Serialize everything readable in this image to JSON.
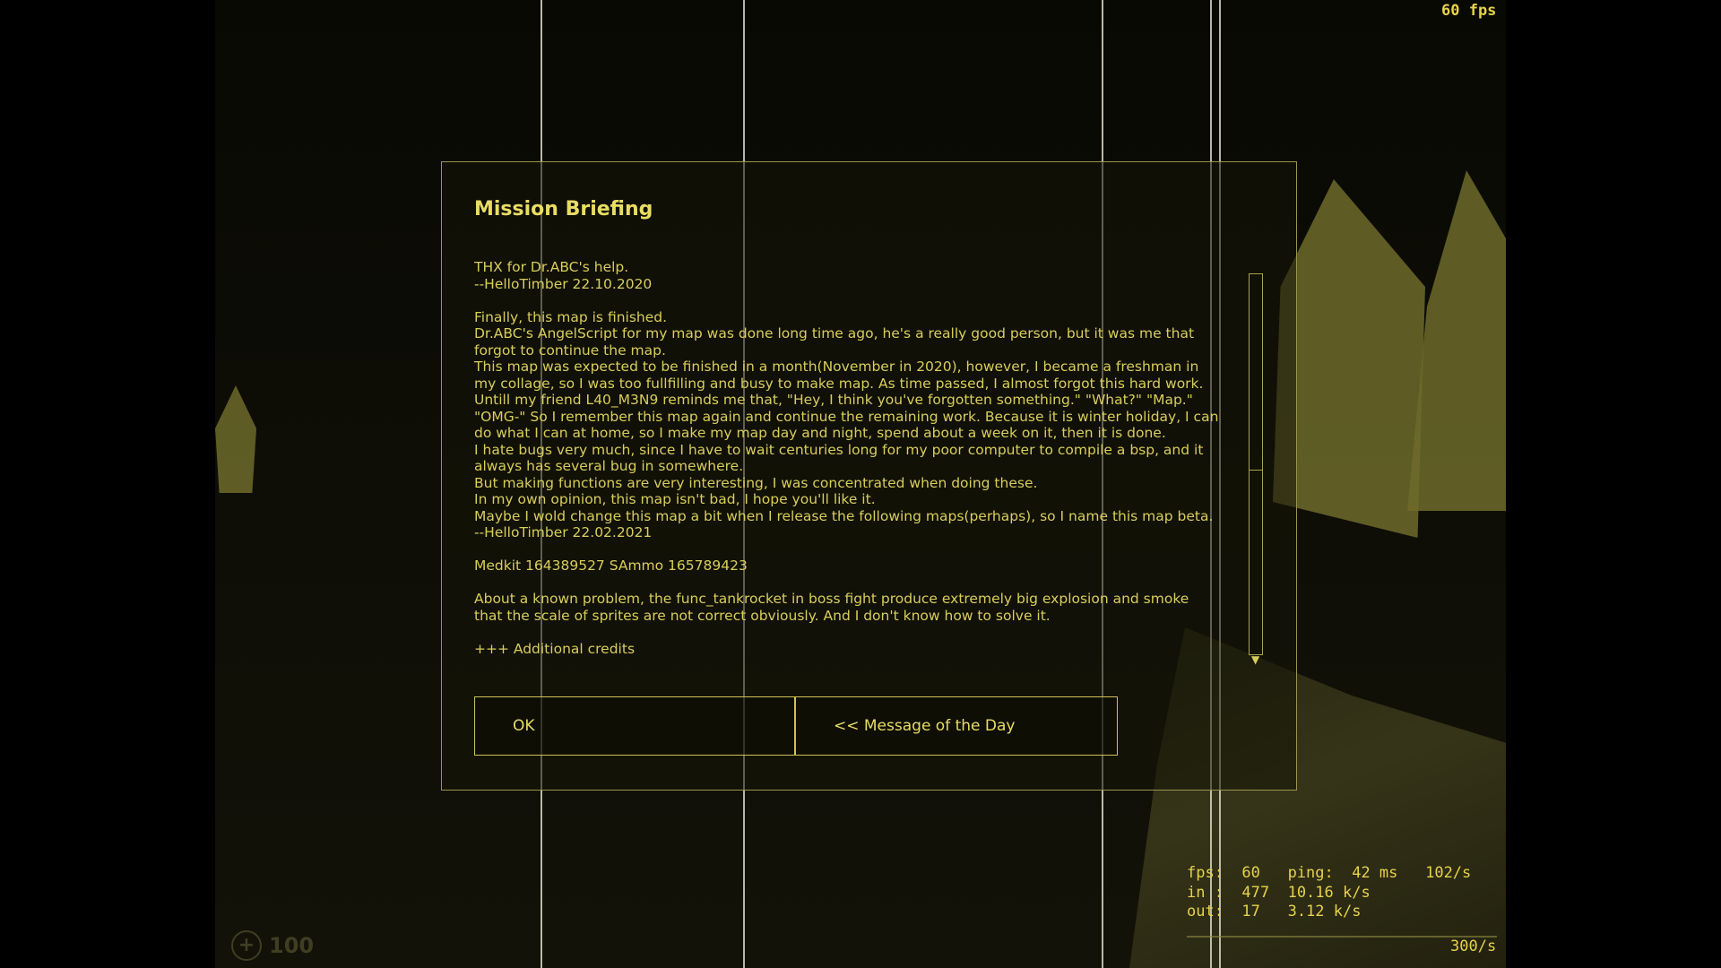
{
  "hud": {
    "fps_top": "60 fps",
    "health_value": "100",
    "health_icon": "cross-icon",
    "netgraph": {
      "line1": "fps:  60   ping:  42 ms   102/s",
      "line2": "in :  477  10.16 k/s",
      "line3": "out:  17   3.12 k/s",
      "rate": "300/s"
    }
  },
  "dialog": {
    "title": "Mission Briefing",
    "briefing_text": "THX for Dr.ABC's help.\n--HelloTimber 22.10.2020\n\nFinally, this map is finished.\nDr.ABC's AngelScript for my map was done long time ago, he's a really good person, but it was me that\nforgot to continue the map.\nThis map was expected to be finished in a month(November in 2020), however, I became a freshman in\nmy collage, so I was too fullfilling and busy to make map. As time passed, I almost forgot this hard work.\nUntill my friend L40_M3N9 reminds me that, \"Hey, I think you've forgotten something.\" \"What?\" \"Map.\"\n\"OMG-\" So I remember this map again and continue the remaining work. Because it is winter holiday, I can\ndo what I can at home, so I make my map day and night, spend about a week on it, then it is done.\nI hate bugs very much, since I have to wait centuries long for my poor computer to compile a bsp, and it\nalways has several bug in somewhere.\nBut making functions are very interesting, I was concentrated when doing these.\nIn my own opinion, this map isn't bad, I hope you'll like it.\nMaybe I wold change this map a bit when I release the following maps(perhaps), so I name this map beta.\n--HelloTimber 22.02.2021\n\nMedkit 164389527 SAmmo 165789423\n\nAbout a known problem, the func_tankrocket in boss fight produce extremely big explosion and smoke\nthat the scale of sprites are not correct obviously. And I don't know how to solve it.\n\n+++ Additional credits",
    "buttons": {
      "ok": "OK",
      "motd": "<< Message of the Day"
    },
    "scroll_arrow": "▼"
  },
  "colors": {
    "accent": "#e9dc62",
    "text": "#d8cd5c",
    "border": "#cfc15a"
  }
}
